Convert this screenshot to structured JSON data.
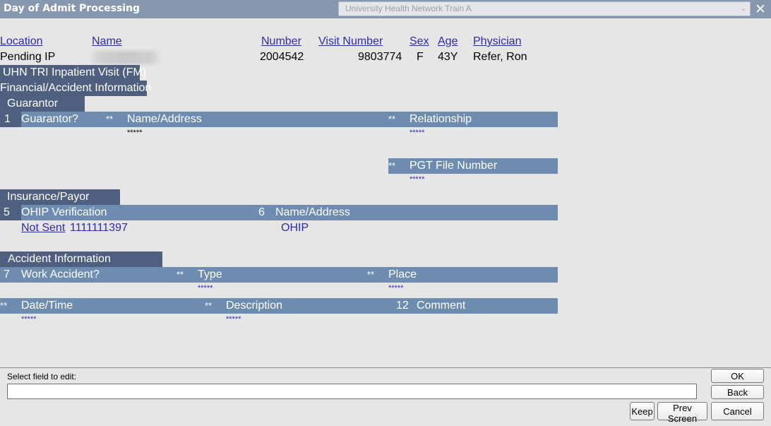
{
  "window": {
    "title": "Day of Admit Processing",
    "environment": "University Health Network Train A",
    "close_glyph": "✕",
    "dropdown_glyph": "⌄"
  },
  "patient_header": {
    "columns": [
      "Location",
      "Name",
      "Number",
      "Visit Number",
      "Sex",
      "Age",
      "Physician"
    ],
    "values": {
      "location": "Pending IP",
      "name": "",
      "number": "2004542",
      "visit_number": "9803774",
      "sex": "F",
      "age": "43Y",
      "physician": "Refer, Ron"
    }
  },
  "visit_type": "UHN TRI Inpatient Visit (FM)",
  "screen_title": "Financial/Accident Information",
  "sections": {
    "guarantor": {
      "title": "Guarantor",
      "band1": {
        "num": "1",
        "label1": "Guarantor?",
        "req2": "**",
        "label2": "Name/Address",
        "req3": "**",
        "label3": "Relationship"
      },
      "name_address_value": "*****",
      "relationship_value": "*****",
      "band2": {
        "req": "**",
        "label": "PGT File Number"
      },
      "pgt_value": "*****"
    },
    "insurance": {
      "title": "Insurance/Payor",
      "band": {
        "num1": "5",
        "label1": "OHIP Verification",
        "num2": "6",
        "label2": "Name/Address"
      },
      "verification_status": "Not Sent",
      "health_card": "1111111397",
      "payor_name": "OHIP"
    },
    "accident": {
      "title": "Accident Information",
      "band1": {
        "num": "7",
        "label1": "Work Accident?",
        "req2": "**",
        "label2": "Type",
        "req3": "**",
        "label3": "Place"
      },
      "type_value": "*****",
      "place_value": "*****",
      "band2": {
        "req1": "**",
        "label1": "Date/Time",
        "req2": "**",
        "label2": "Description",
        "num3": "12",
        "label3": "Comment"
      },
      "datetime_value": "*****",
      "description_value": "*****"
    }
  },
  "footer": {
    "prompt": "Select field to edit:",
    "field_value": "",
    "buttons": {
      "ok": "OK",
      "back": "Back",
      "keep": "Keep",
      "prev_screen": "Prev Screen",
      "cancel": "Cancel"
    }
  }
}
